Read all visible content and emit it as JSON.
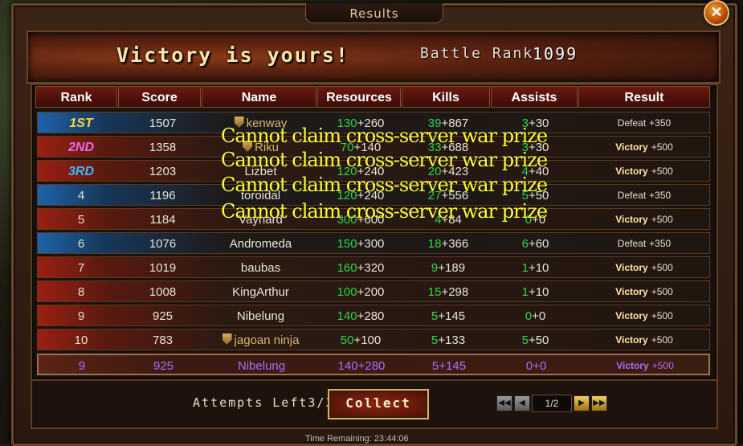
{
  "window": {
    "title": "Results",
    "close_glyph": "✕"
  },
  "banner": {
    "headline": "Victory is yours!",
    "battle_rank_label": "Battle Rank:",
    "battle_rank_value": "1099"
  },
  "columns": [
    "Rank",
    "Score",
    "Name",
    "Resources",
    "Kills",
    "Assists",
    "Result"
  ],
  "rows": [
    {
      "rank": "1ST",
      "score": "1507",
      "name": "kenway",
      "shield": true,
      "res_a": "130",
      "res_b": "+260",
      "kills_a": "39",
      "kills_b": "+867",
      "ass_a": "3",
      "ass_b": "+30",
      "result": "Defeat",
      "bonus": "+350",
      "team": "blue",
      "rank_color": "#ffd43a"
    },
    {
      "rank": "2ND",
      "score": "1358",
      "name": "Riku",
      "shield": true,
      "res_a": "70",
      "res_b": "+140",
      "kills_a": "33",
      "kills_b": "+688",
      "ass_a": "3",
      "ass_b": "+30",
      "result": "Victory",
      "bonus": "+500",
      "team": "red",
      "rank_color": "#e86bf0"
    },
    {
      "rank": "3RD",
      "score": "1203",
      "name": "Lizbet",
      "shield": false,
      "res_a": "120",
      "res_b": "+240",
      "kills_a": "20",
      "kills_b": "+423",
      "ass_a": "4",
      "ass_b": "+40",
      "result": "Victory",
      "bonus": "+500",
      "team": "red",
      "rank_color": "#3ab8ff"
    },
    {
      "rank": "4",
      "score": "1196",
      "name": "toroidal",
      "shield": false,
      "res_a": "120",
      "res_b": "+240",
      "kills_a": "27",
      "kills_b": "+556",
      "ass_a": "5",
      "ass_b": "+50",
      "result": "Defeat",
      "bonus": "+350",
      "team": "blue",
      "rank_color": ""
    },
    {
      "rank": "5",
      "score": "1184",
      "name": "Vaynard",
      "shield": false,
      "res_a": "300",
      "res_b": "+600",
      "kills_a": "4",
      "kills_b": "+84",
      "ass_a": "0",
      "ass_b": "+0",
      "result": "Victory",
      "bonus": "+500",
      "team": "red",
      "rank_color": ""
    },
    {
      "rank": "6",
      "score": "1076",
      "name": "Andromeda",
      "shield": false,
      "res_a": "150",
      "res_b": "+300",
      "kills_a": "18",
      "kills_b": "+366",
      "ass_a": "6",
      "ass_b": "+60",
      "result": "Defeat",
      "bonus": "+350",
      "team": "blue",
      "rank_color": ""
    },
    {
      "rank": "7",
      "score": "1019",
      "name": "baubas",
      "shield": false,
      "res_a": "160",
      "res_b": "+320",
      "kills_a": "9",
      "kills_b": "+189",
      "ass_a": "1",
      "ass_b": "+10",
      "result": "Victory",
      "bonus": "+500",
      "team": "red",
      "rank_color": ""
    },
    {
      "rank": "8",
      "score": "1008",
      "name": "KingArthur",
      "shield": false,
      "res_a": "100",
      "res_b": "+200",
      "kills_a": "15",
      "kills_b": "+298",
      "ass_a": "1",
      "ass_b": "+10",
      "result": "Victory",
      "bonus": "+500",
      "team": "red",
      "rank_color": ""
    },
    {
      "rank": "9",
      "score": "925",
      "name": "Nibelung",
      "shield": false,
      "res_a": "140",
      "res_b": "+280",
      "kills_a": "5",
      "kills_b": "+145",
      "ass_a": "0",
      "ass_b": "+0",
      "result": "Victory",
      "bonus": "+500",
      "team": "red",
      "rank_color": ""
    },
    {
      "rank": "10",
      "score": "783",
      "name": "jagoan ninja",
      "shield": true,
      "res_a": "50",
      "res_b": "+100",
      "kills_a": "5",
      "kills_b": "+133",
      "ass_a": "5",
      "ass_b": "+50",
      "result": "Victory",
      "bonus": "+500",
      "team": "red",
      "rank_color": ""
    }
  ],
  "self_row": {
    "rank": "9",
    "score": "925",
    "name": "Nibelung",
    "res_a": "140",
    "res_b": "+280",
    "kills_a": "5",
    "kills_b": "+145",
    "ass_a": "0",
    "ass_b": "+0",
    "result": "Victory",
    "bonus": "+500",
    "color": "#b06cff"
  },
  "overlays": [
    "Cannot claim cross-server war prize",
    "Cannot claim cross-server war prize",
    "Cannot claim cross-server war prize",
    "Cannot claim cross-server war prize"
  ],
  "footer": {
    "attempts_label": "Attempts Left",
    "attempts_value": "3/3",
    "collect_label": "Collect",
    "page": "1/2",
    "first": "◀◀",
    "prev": "◀",
    "next": "▶",
    "last": "▶▶"
  },
  "bottom_strip": "Time Remaining: 23:44:06",
  "colors": {
    "green": "#2bd64a",
    "gold": "#ffe7a0",
    "self": "#b06cff"
  }
}
